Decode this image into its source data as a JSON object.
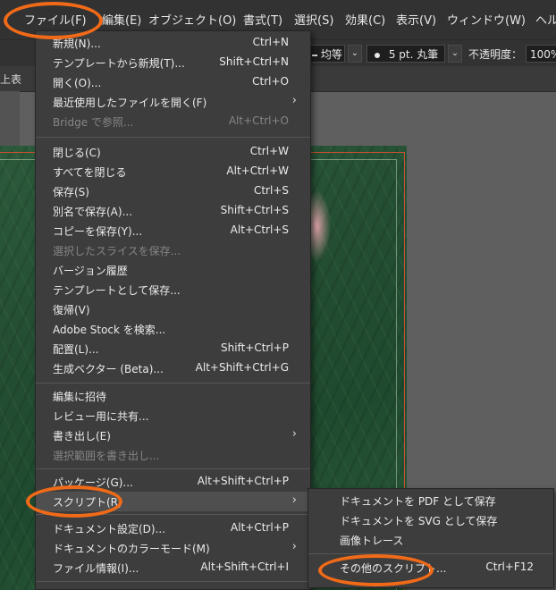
{
  "menubar": {
    "items": [
      "ファイル(F)",
      "編集(E)",
      "オブジェクト(O)",
      "書式(T)",
      "選択(S)",
      "効果(C)",
      "表示(V)",
      "ウィンドウ(W)",
      "ヘル"
    ]
  },
  "toolbar": {
    "stroke_profile": "均等",
    "brush": "5 pt. 丸筆",
    "opacity_label": "不透明度：",
    "opacity_value": "100%",
    "left_fragment": "上表"
  },
  "file_menu": {
    "items": [
      {
        "label": "新規(N)...",
        "shortcut": "Ctrl+N"
      },
      {
        "label": "テンプレートから新規(T)...",
        "shortcut": "Shift+Ctrl+N"
      },
      {
        "label": "開く(O)...",
        "shortcut": "Ctrl+O"
      },
      {
        "label": "最近使用したファイルを開く(F)",
        "shortcut": ""
      },
      {
        "label": "Bridge で参照...",
        "shortcut": "Alt+Ctrl+O"
      },
      {
        "label": "閉じる(C)",
        "shortcut": "Ctrl+W"
      },
      {
        "label": "すべてを閉じる",
        "shortcut": "Alt+Ctrl+W"
      },
      {
        "label": "保存(S)",
        "shortcut": "Ctrl+S"
      },
      {
        "label": "別名で保存(A)...",
        "shortcut": "Shift+Ctrl+S"
      },
      {
        "label": "コピーを保存(Y)...",
        "shortcut": "Alt+Ctrl+S"
      },
      {
        "label": "選択したスライスを保存...",
        "shortcut": ""
      },
      {
        "label": "バージョン履歴",
        "shortcut": ""
      },
      {
        "label": "テンプレートとして保存...",
        "shortcut": ""
      },
      {
        "label": "復帰(V)",
        "shortcut": ""
      },
      {
        "label": "Adobe Stock を検索...",
        "shortcut": ""
      },
      {
        "label": "配置(L)...",
        "shortcut": "Shift+Ctrl+P"
      },
      {
        "label": "生成ベクター (Beta)...",
        "shortcut": "Alt+Shift+Ctrl+G"
      },
      {
        "label": "編集に招待",
        "shortcut": ""
      },
      {
        "label": "レビュー用に共有...",
        "shortcut": ""
      },
      {
        "label": "書き出し(E)",
        "shortcut": ""
      },
      {
        "label": "選択範囲を書き出し...",
        "shortcut": ""
      },
      {
        "label": "パッケージ(G)...",
        "shortcut": "Alt+Shift+Ctrl+P"
      },
      {
        "label": "スクリプト(R)",
        "shortcut": ""
      },
      {
        "label": "ドキュメント設定(D)...",
        "shortcut": "Alt+Ctrl+P"
      },
      {
        "label": "ドキュメントのカラーモード(M)",
        "shortcut": ""
      },
      {
        "label": "ファイル情報(I)...",
        "shortcut": "Alt+Shift+Ctrl+I"
      }
    ]
  },
  "script_submenu": {
    "items": [
      {
        "label": "ドキュメントを PDF として保存",
        "shortcut": ""
      },
      {
        "label": "ドキュメントを SVG として保存",
        "shortcut": ""
      },
      {
        "label": "画像トレース",
        "shortcut": ""
      },
      {
        "label": "その他のスクリプト...",
        "shortcut": "Ctrl+F12"
      }
    ]
  },
  "colors": {
    "highlight_ring": "#f06a18",
    "menu_bg": "#3d3d3d",
    "artboard_green": "#244e33"
  }
}
